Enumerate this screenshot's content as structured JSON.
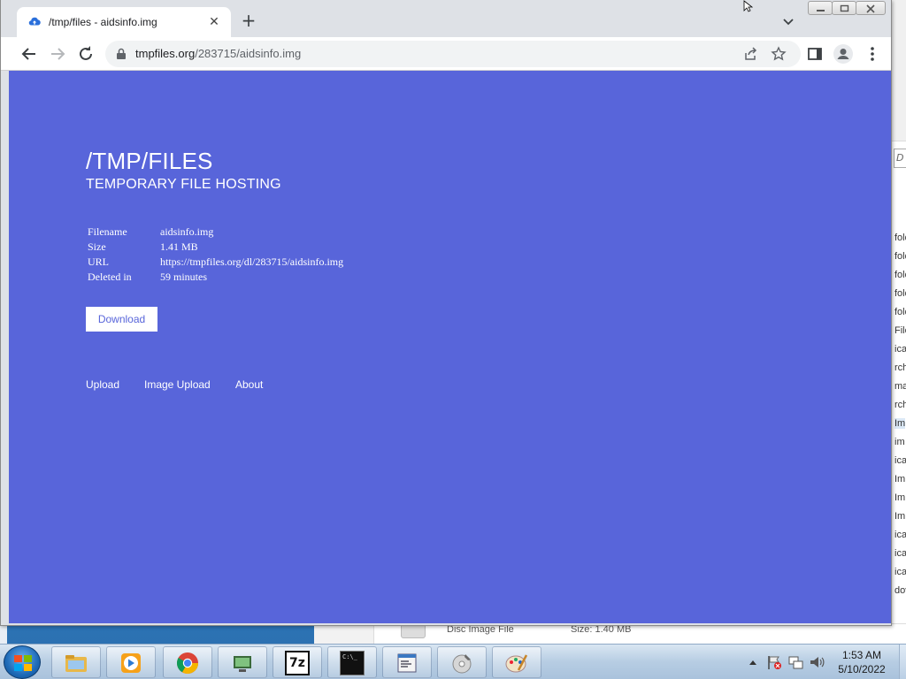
{
  "browser": {
    "tab_title": "/tmp/files - aidsinfo.img",
    "url_host": "tmpfiles.org",
    "url_path": "/283715/aidsinfo.img"
  },
  "page": {
    "title": "/TMP/FILES",
    "subtitle": "TEMPORARY FILE HOSTING",
    "file_info": [
      {
        "label": "Filename",
        "value": "aidsinfo.img"
      },
      {
        "label": "Size",
        "value": "1.41 MB"
      },
      {
        "label": "URL",
        "value": "https://tmpfiles.org/dl/283715/aidsinfo.img"
      },
      {
        "label": "Deleted in",
        "value": "59 minutes"
      }
    ],
    "download_label": "Download",
    "footer_links": [
      "Upload",
      "Image Upload",
      "About"
    ],
    "colors": {
      "background": "#5865da",
      "text": "#ffffff"
    }
  },
  "background_window": {
    "search_fragment": "D",
    "list_fragments": [
      "fold",
      "fold",
      "fold",
      "fold",
      "fold",
      "File",
      "ica",
      "rch",
      "ma",
      "rch",
      "Im",
      "im",
      "ica",
      "Im",
      "Im",
      "Im",
      "ica",
      "ica",
      "ica",
      "dov"
    ],
    "bottom_row": {
      "type": "Disc Image File",
      "size": "Size: 1.40 MB"
    }
  },
  "taskbar": {
    "apps": [
      "explorer-icon",
      "media-player-icon",
      "chrome-icon",
      "network-icon",
      "7zip-icon",
      "cmd-icon",
      "notepad-icon",
      "disc-burn-icon",
      "paint-icon"
    ],
    "app_7zip_label": "7z",
    "cmd_label": "C:\\_",
    "time": "1:53 AM",
    "date": "5/10/2022"
  }
}
